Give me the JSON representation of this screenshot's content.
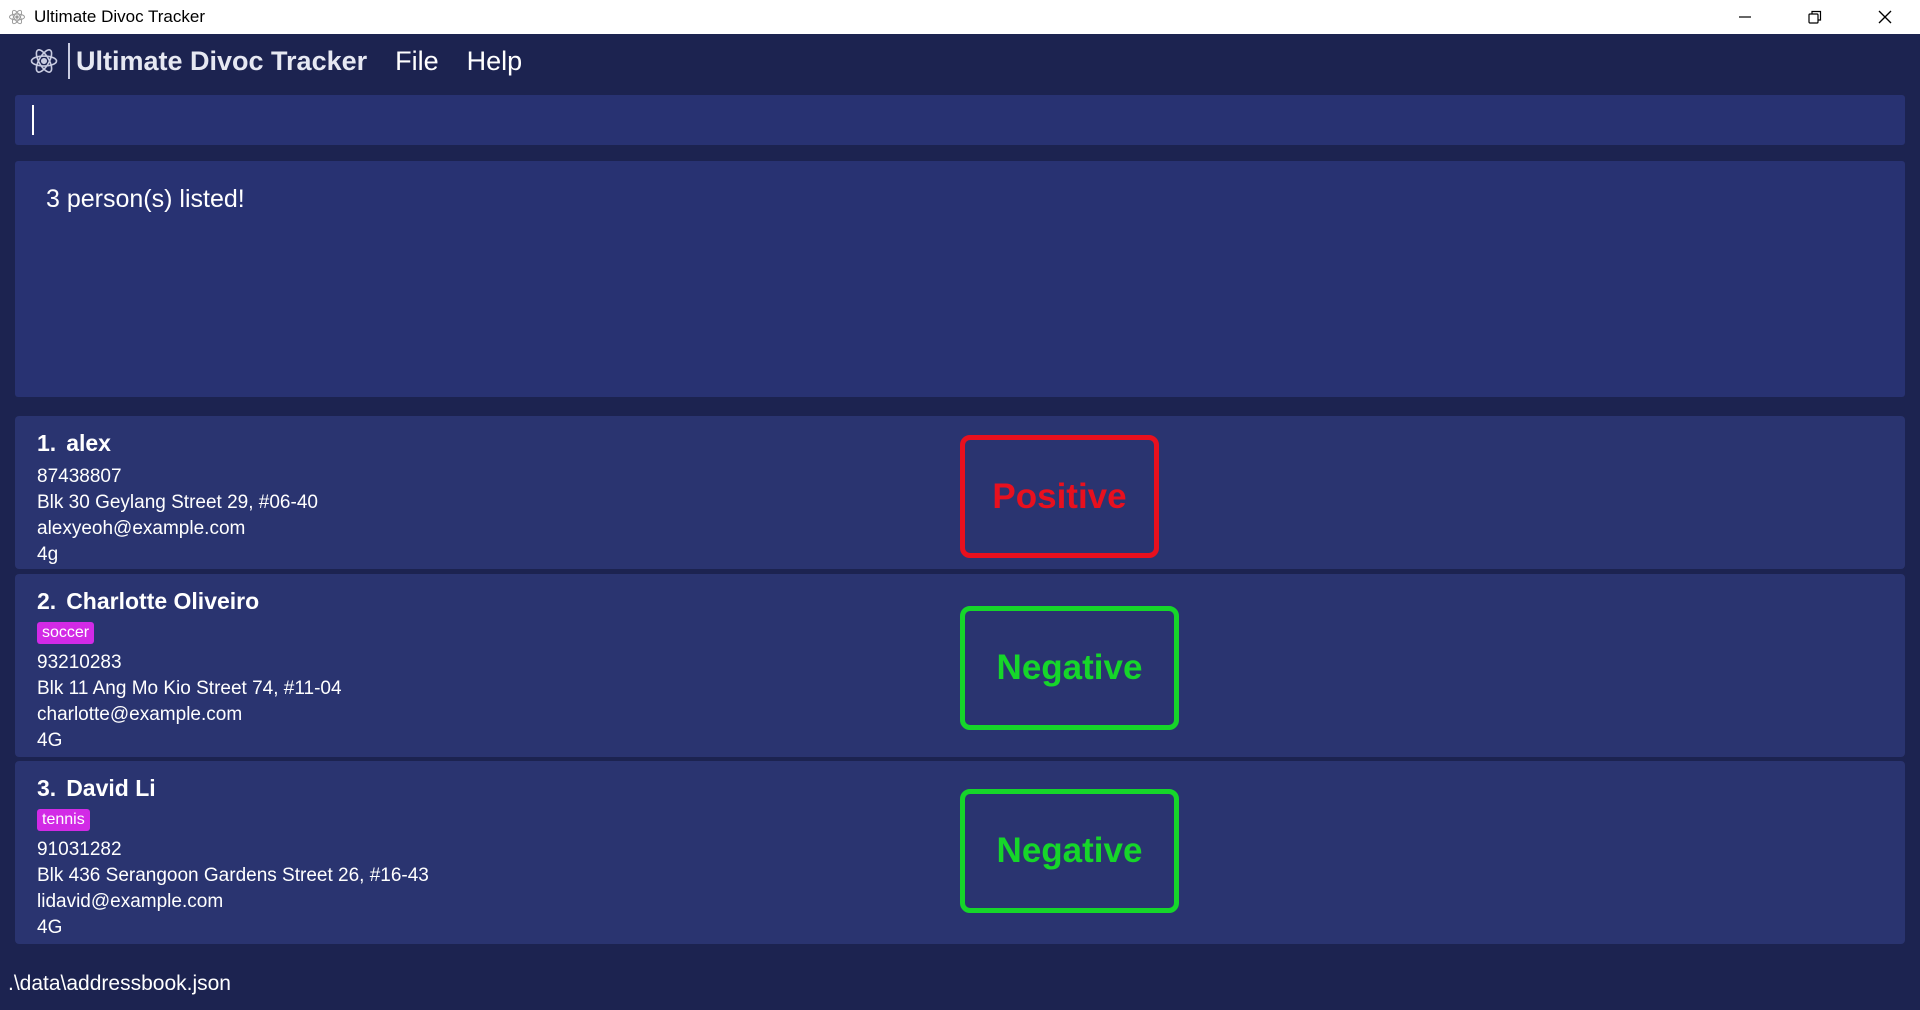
{
  "window": {
    "title": "Ultimate Divoc Tracker"
  },
  "menubar": {
    "app_name": "Ultimate Divoc Tracker",
    "items": [
      "File",
      "Help"
    ]
  },
  "command": {
    "value": "",
    "placeholder": ""
  },
  "result": {
    "message": "3 person(s) listed!"
  },
  "persons": [
    {
      "index": "1.",
      "name": "alex",
      "tag": "",
      "phone": "87438807",
      "address": "Blk 30 Geylang Street 29, #06-40",
      "email": "alexyeoh@example.com",
      "group": "4g",
      "status": "Positive",
      "status_color": "#e8101e"
    },
    {
      "index": "2.",
      "name": "Charlotte Oliveiro",
      "tag": "soccer",
      "phone": "93210283",
      "address": "Blk 11 Ang Mo Kio Street 74, #11-04",
      "email": "charlotte@example.com",
      "group": "4G",
      "status": "Negative",
      "status_color": "#16d62a"
    },
    {
      "index": "3.",
      "name": "David Li",
      "tag": "tennis",
      "phone": "91031282",
      "address": "Blk 436 Serangoon Gardens Street 26, #16-43",
      "email": "lidavid@example.com",
      "group": "4G",
      "status": "Negative",
      "status_color": "#16d62a"
    }
  ],
  "statusbar": {
    "file_path": ".\\data\\addressbook.json"
  },
  "colors": {
    "background": "#1c2350",
    "panel": "#283272",
    "card": "#2a3470",
    "tag": "#d22ae6"
  },
  "icons": {
    "app": "atom-icon",
    "minimize": "minimize-icon",
    "restore": "restore-icon",
    "close": "close-icon"
  }
}
